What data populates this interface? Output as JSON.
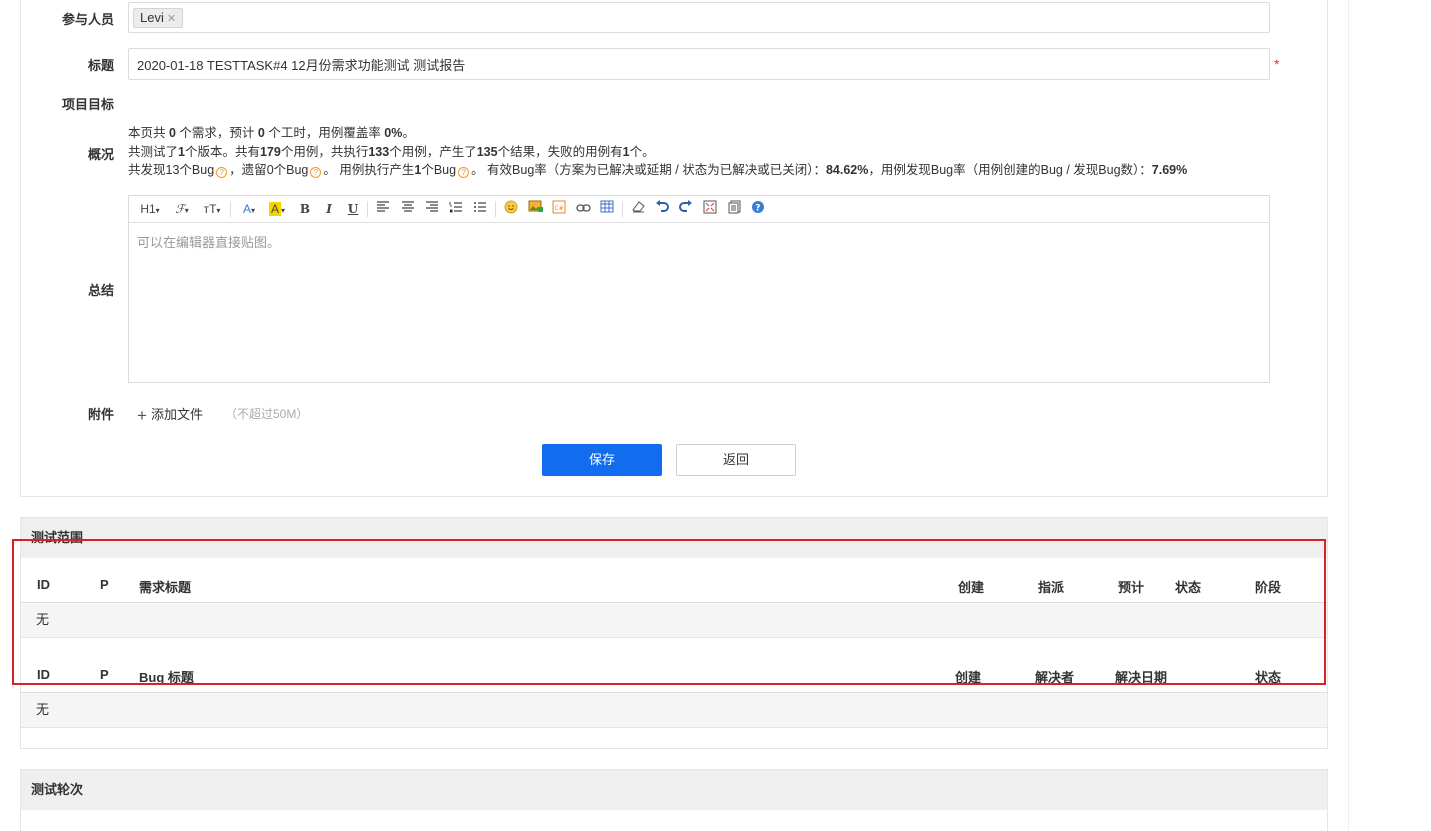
{
  "form": {
    "members_label": "参与人员",
    "members": [
      {
        "name": "Levi",
        "remove": "✕"
      }
    ],
    "title_label": "标题",
    "title_value": "2020-01-18 TESTTASK#4 12月份需求功能测试 测试报告",
    "required_mark": "*",
    "goal_label": "项目目标",
    "overview_label": "概况",
    "overview": {
      "l1": {
        "a": "本页共 ",
        "b": "0",
        "c": " 个需求，预计 ",
        "d": "0",
        "e": " 个工时，用例覆盖率 ",
        "f": "0%",
        "g": "。"
      },
      "l2": {
        "a": "共测试了",
        "b": "1",
        "c": "个版本。共有",
        "d": "179",
        "e": "个用例，共执行",
        "f": "133",
        "g": "个用例，产生了",
        "h": "135",
        "i": "个结果，失败的用例有",
        "j": "1",
        "k": "个。"
      },
      "l3": {
        "a": "共发现",
        "b": "13",
        "c": "个Bug",
        "d": "，遗留",
        "e": "0",
        "f": "个Bug",
        "g": "。 用例执行产生",
        "h": "1",
        "i": "个Bug",
        "j": "。 有效Bug率（方案为已解决或延期 / 状态为已解决或已关闭）：",
        "k": "84.62%",
        "l": "，用例发现Bug率（用例创建的Bug / 发现Bug数）：",
        "m": "7.69%"
      }
    },
    "summary_label": "总结",
    "editor_placeholder": "可以在编辑器直接贴图。",
    "attach_label": "附件",
    "attach_add": "添加文件",
    "attach_hint": "（不超过50M）",
    "save_button": "保存",
    "back_button": "返回"
  },
  "toolbar": {
    "heading": "H1",
    "font_family": "ℱ",
    "font_size": "тT",
    "font_color": "A",
    "back_color": "A",
    "bold": "B",
    "italic": "I",
    "underline": "U"
  },
  "scope": {
    "title": "测试范围",
    "story_headers": {
      "id": "ID",
      "pri": "P",
      "title": "需求标题",
      "created": "创建",
      "assigned": "指派",
      "estimate": "预计",
      "status": "状态",
      "stage": "阶段"
    },
    "story_empty": "无",
    "bug_headers": {
      "id": "ID",
      "pri": "P",
      "title": "Bug 标题",
      "created": "创建",
      "resolver": "解决者",
      "resolved_date": "解决日期",
      "status": "状态"
    },
    "bug_empty": "无"
  },
  "rounds": {
    "title": "测试轮次"
  },
  "colors": {
    "primary": "#116cee",
    "required": "#e53333",
    "highlight": "#e02020"
  }
}
